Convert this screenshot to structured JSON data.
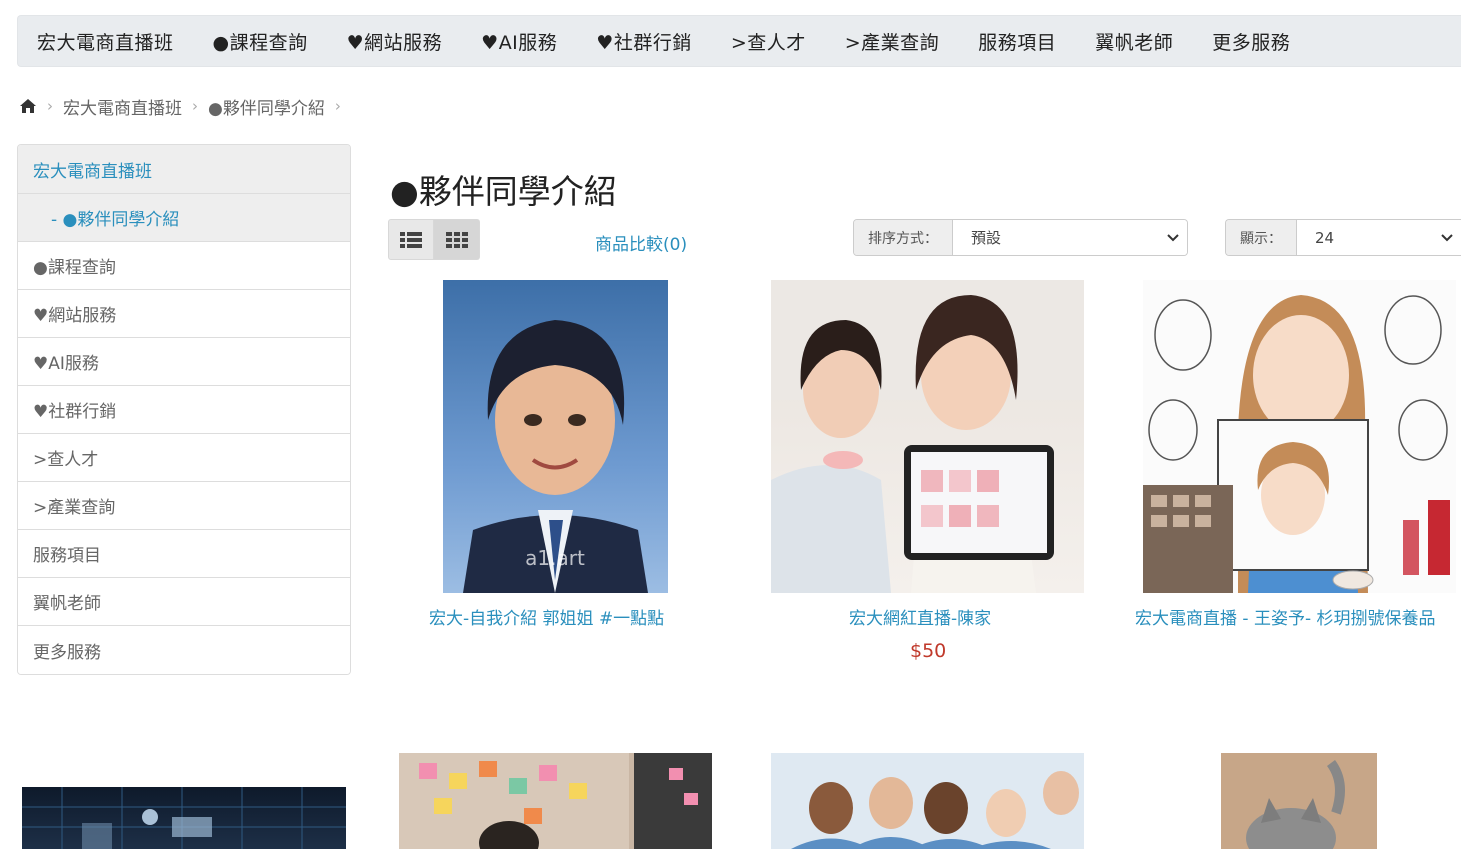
{
  "nav": {
    "items": [
      "宏大電商直播班",
      "●課程查詢",
      "♥網站服務",
      "♥AI服務",
      "♥社群行銷",
      ">查人才",
      ">產業查詢",
      "服務項目",
      "翼帆老師",
      "更多服務"
    ]
  },
  "breadcrumb": {
    "home_icon": "home-icon",
    "items": [
      "宏大電商直播班",
      "●夥伴同學介紹"
    ]
  },
  "sidebar": {
    "items": [
      "宏大電商直播班",
      "- ●夥伴同學介紹",
      "●課程查詢",
      "♥網站服務",
      "♥AI服務",
      "♥社群行銷",
      ">查人才",
      ">產業查詢",
      "服務項目",
      "翼帆老師",
      "更多服務"
    ]
  },
  "main": {
    "title": "●夥伴同學介紹",
    "compare": "商品比較(0)",
    "sort_label": "排序方式：",
    "sort_value": "預設",
    "show_label": "顯示：",
    "show_value": "24"
  },
  "products": [
    {
      "name": "宏大-自我介紹 郭姐姐 #一點點",
      "watermark": "a1.art"
    },
    {
      "name": "宏大網紅直播-陳家",
      "price": "$50"
    },
    {
      "name": "宏大電商直播 - 王姿予- 杉玥捌號保養品"
    }
  ],
  "colors": {
    "link": "#2a8fbd",
    "price": "#c0392b",
    "nav_bg": "#e9ecef",
    "active_bg": "#eeeeee"
  }
}
